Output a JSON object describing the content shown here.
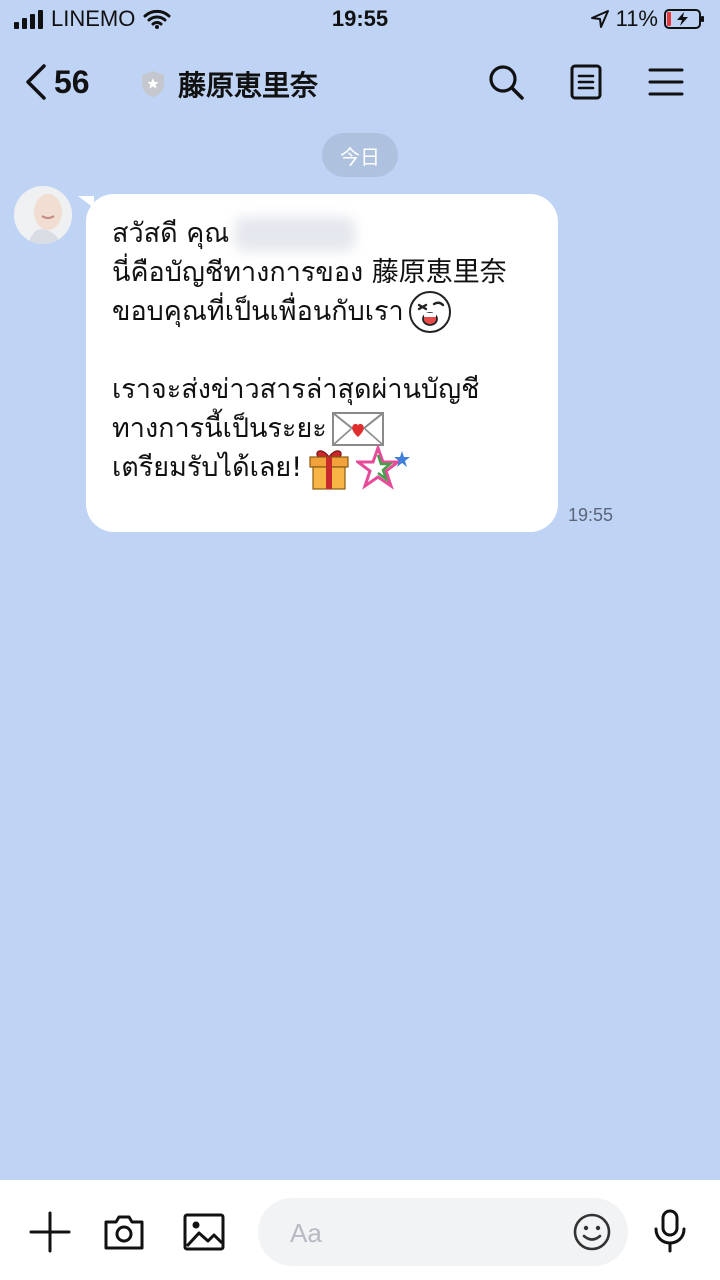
{
  "status_bar": {
    "carrier": "LINEMO",
    "time": "19:55",
    "battery": "11%"
  },
  "header": {
    "back_count": "56",
    "title": "藤原恵里奈"
  },
  "chat": {
    "date_separator": "今日",
    "message": {
      "line1": "สวัสดี คุณ",
      "line2": "นี่คือบัญชีทางการของ 藤原恵里奈",
      "line3": "ขอบคุณที่เป็นเพื่อนกับเรา",
      "line4": "เราจะส่งข่าวสารล่าสุดผ่านบัญชี",
      "line5": "ทางการนี้เป็นระยะ",
      "line6": "เตรียมรับได้เลย!",
      "time": "19:55"
    }
  },
  "composer": {
    "placeholder": "Aa"
  },
  "colors": {
    "background": "#bfd3f5",
    "bubble": "#ffffff"
  },
  "icons": [
    "back-chevron-icon",
    "official-shield-icon",
    "search-icon",
    "notes-icon",
    "menu-icon",
    "plus-icon",
    "camera-icon",
    "image-icon",
    "emoji-icon",
    "microphone-icon"
  ]
}
